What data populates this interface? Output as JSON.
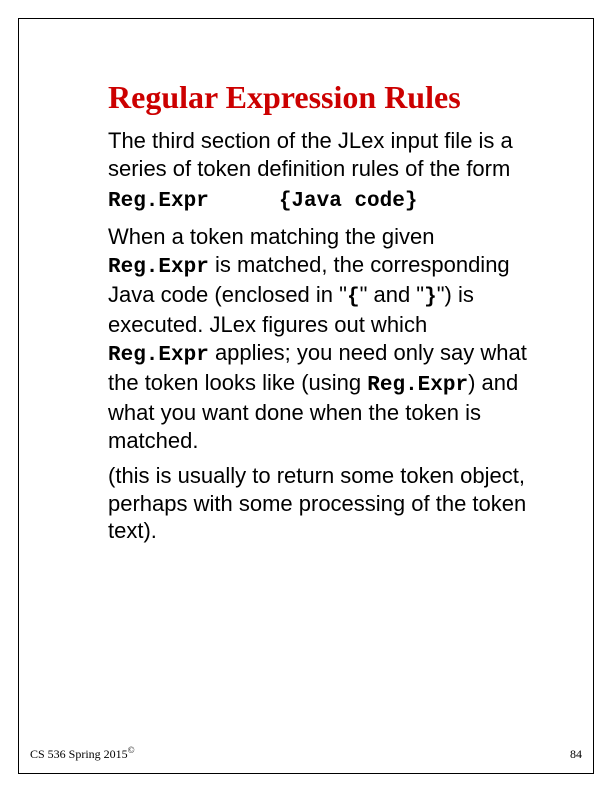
{
  "title": "Regular Expression Rules",
  "para1": "The third section of the JLex input file is a series of token definition rules of the form",
  "rule": {
    "lhs": "Reg.Expr",
    "rhs": "{Java code}"
  },
  "para2": {
    "t1": "When a token matching the given ",
    "c1": "Reg.Expr",
    "t2": " is matched, the corresponding Java code (enclosed in \"",
    "c2": "{",
    "t3": "\" and \"",
    "c3": "}",
    "t4": "\") is executed. JLex figures out which ",
    "c4": "Reg.Expr",
    "t5": " applies; you need only say what the token looks like (using ",
    "c5": "Reg.Expr",
    "t6": ") and what you want done when the token is matched."
  },
  "para3": "(this is usually to return some token object, perhaps with some processing of the token text).",
  "footer": {
    "course": "CS 536  Spring 2015",
    "copyright": "©",
    "page": "84"
  }
}
